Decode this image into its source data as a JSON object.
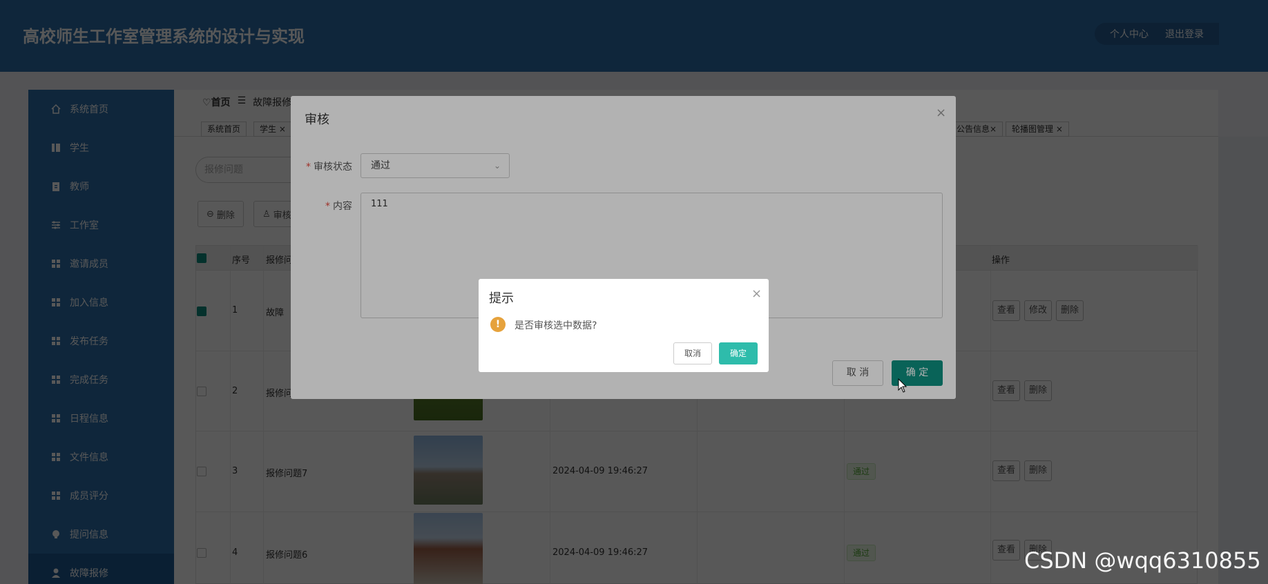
{
  "header": {
    "title": "高校师生工作室管理系统的设计与实现",
    "links": [
      "个人中心",
      "退出登录"
    ]
  },
  "sidebar": {
    "items": [
      {
        "label": "系统首页",
        "icon": "home-icon"
      },
      {
        "label": "学生",
        "icon": "book-icon"
      },
      {
        "label": "教师",
        "icon": "clipboard-icon"
      },
      {
        "label": "工作室",
        "icon": "sliders-icon"
      },
      {
        "label": "邀请成员",
        "icon": "grid-icon"
      },
      {
        "label": "加入信息",
        "icon": "grid-icon"
      },
      {
        "label": "发布任务",
        "icon": "grid-icon"
      },
      {
        "label": "完成任务",
        "icon": "grid-icon"
      },
      {
        "label": "日程信息",
        "icon": "grid-icon"
      },
      {
        "label": "文件信息",
        "icon": "grid-icon"
      },
      {
        "label": "成员评分",
        "icon": "grid-icon"
      },
      {
        "label": "提问信息",
        "icon": "bulb-icon"
      },
      {
        "label": "故障报修",
        "icon": "user-icon"
      }
    ]
  },
  "breadcrumb": {
    "home": "首页",
    "current": "故障报修"
  },
  "tags": [
    "系统首页",
    "学生",
    "公告信息",
    "轮播图管理"
  ],
  "search": {
    "placeholder": "报修问题"
  },
  "toolbar": {
    "delete": "删除",
    "audit": "审核"
  },
  "table": {
    "headers": {
      "seq": "序号",
      "problem": "报修问",
      "actions": "操作"
    },
    "rows": [
      {
        "seq": "1",
        "problem": "故障",
        "time": "",
        "status": "",
        "actions": [
          "查看",
          "修改",
          "删除"
        ],
        "checked": true
      },
      {
        "seq": "2",
        "problem": "报修问",
        "time": "",
        "status": "",
        "actions": [
          "查看",
          "删除"
        ],
        "checked": false
      },
      {
        "seq": "3",
        "problem": "报修问题7",
        "time": "2024-04-09 19:46:27",
        "status": "通过",
        "actions": [
          "查看",
          "删除"
        ],
        "checked": false
      },
      {
        "seq": "4",
        "problem": "报修问题6",
        "time": "2024-04-09 19:46:27",
        "status": "通过",
        "actions": [
          "查看",
          "删除"
        ],
        "checked": false
      }
    ]
  },
  "audit_dialog": {
    "title": "审核",
    "status_label": "审核状态",
    "status_value": "通过",
    "content_label": "内容",
    "content_value": "111",
    "cancel": "取 消",
    "ok": "确 定"
  },
  "confirm_dialog": {
    "title": "提示",
    "message": "是否审核选中数据?",
    "cancel": "取消",
    "ok": "确定"
  },
  "watermark": "CSDN @wqq6310855",
  "colors": {
    "header": "#2d6fab",
    "primary": "#0d8f7e",
    "confirm": "#2ebcab",
    "warning": "#e6a23c"
  }
}
